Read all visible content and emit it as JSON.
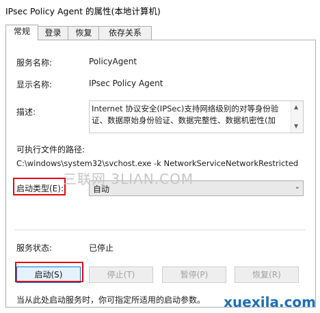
{
  "window": {
    "title": "IPsec Policy Agent 的属性(本地计算机)"
  },
  "tabs": [
    {
      "label": "常规"
    },
    {
      "label": "登录"
    },
    {
      "label": "恢复"
    },
    {
      "label": "依存关系"
    }
  ],
  "general": {
    "service_name_label": "服务名称:",
    "service_name_value": "PolicyAgent",
    "display_name_label": "显示名称:",
    "display_name_value": "IPsec Policy Agent",
    "description_label": "描述:",
    "description_lines": [
      "Internet 协议安全(IPSec)支持网络级别的对等身份验",
      "证、数据原始身份验证、数据完整性、数据机密性(加"
    ],
    "path_label": "可执行文件的路径:",
    "path_value": "C:\\windows\\system32\\svchost.exe -k NetworkServiceNetworkRestricted",
    "startup_type_label": "启动类型(E):",
    "startup_type_value": "自动",
    "status_label": "服务状态:",
    "status_value": "已停止",
    "buttons": {
      "start": "启动(S)",
      "stop": "停止(T)",
      "pause": "暂停(P)",
      "resume": "恢复(R)"
    },
    "hint": "当从此处启动服务时，你可指定所适用的启动参数。"
  },
  "overlays": {
    "watermark": "三联网 3LIAN.COM",
    "site": "xuexila.com",
    "highlight_color": "#e60012"
  }
}
